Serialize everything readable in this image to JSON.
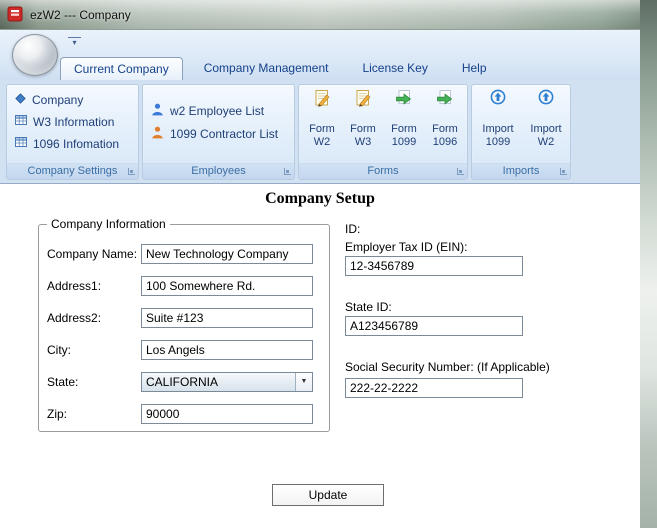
{
  "window": {
    "title": "ezW2 --- Company"
  },
  "icons": {
    "combo_arrow": "▼",
    "qat_dropdown": "▾"
  },
  "colors": {
    "accent_blue": "#15428b",
    "caption_blue": "#3a6ea5",
    "ribbon_bg": "#d2e1f2",
    "person_blue": "#3b7ad6",
    "person_orange": "#e07f2e",
    "import_blue": "#2f7fd0",
    "form_green": "#46b257",
    "pencil_orange": "#f2b13e"
  },
  "ribbon": {
    "tabs": [
      {
        "label": "Current Company",
        "active": true
      },
      {
        "label": "Company Management",
        "active": false
      },
      {
        "label": "License Key",
        "active": false
      },
      {
        "label": "Help",
        "active": false
      }
    ],
    "groups": {
      "company_settings": {
        "label": "Company Settings",
        "items": [
          {
            "label": "Company",
            "icon": "diamond-icon"
          },
          {
            "label": "W3 Information",
            "icon": "table-icon"
          },
          {
            "label": "1096 Infomation",
            "icon": "table-icon"
          }
        ]
      },
      "employees": {
        "label": "Employees",
        "items": [
          {
            "label": "w2 Employee List",
            "icon": "person-blue-icon"
          },
          {
            "label": "1099 Contractor List",
            "icon": "person-orange-icon"
          }
        ]
      },
      "forms": {
        "label": "Forms",
        "items": [
          {
            "line1": "Form",
            "line2": "W2",
            "icon": "form-pencil-icon"
          },
          {
            "line1": "Form",
            "line2": "W3",
            "icon": "form-pencil-icon"
          },
          {
            "line1": "Form",
            "line2": "1099",
            "icon": "form-arrow-icon"
          },
          {
            "line1": "Form",
            "line2": "1096",
            "icon": "form-arrow-icon"
          }
        ]
      },
      "imports": {
        "label": "Imports",
        "items": [
          {
            "line1": "Import",
            "line2": "1099",
            "icon": "import-icon"
          },
          {
            "line1": "Import",
            "line2": "W2",
            "icon": "import-icon"
          }
        ]
      }
    }
  },
  "main": {
    "title": "Company Setup",
    "company_information": {
      "legend": "Company Information",
      "fields": [
        {
          "label": "Company Name:",
          "value": "New Technology Company"
        },
        {
          "label": "Address1:",
          "value": "100 Somewhere Rd."
        },
        {
          "label": "Address2:",
          "value": "Suite #123"
        },
        {
          "label": "City:",
          "value": "Los Angels"
        },
        {
          "label": "State:",
          "value": "CALIFORNIA"
        },
        {
          "label": "Zip:",
          "value": "90000"
        }
      ]
    },
    "ids": {
      "heading": "ID:",
      "fields": [
        {
          "label": "Employer Tax ID (EIN):",
          "value": "12-3456789"
        },
        {
          "label": "State ID:",
          "value": "A123456789"
        },
        {
          "label": "Social Security Number: (If Applicable)",
          "value": "222-22-2222"
        }
      ]
    },
    "update_button": "Update"
  }
}
